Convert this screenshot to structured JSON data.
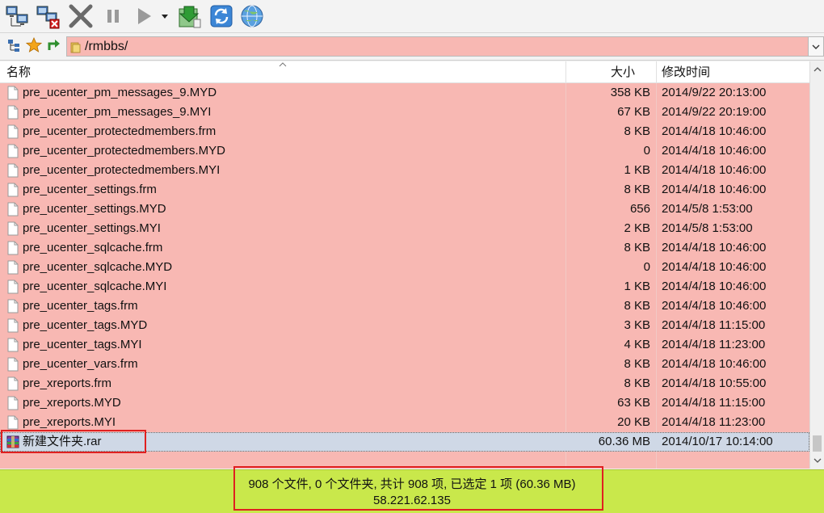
{
  "toolbar": {
    "buttons": [
      {
        "icon": "connect-icon"
      },
      {
        "icon": "disconnect-icon"
      },
      {
        "icon": "cancel-icon"
      },
      {
        "icon": "pause-icon"
      },
      {
        "icon": "play-icon"
      },
      {
        "icon": "sync-download-icon"
      },
      {
        "icon": "refresh-icon"
      },
      {
        "icon": "globe-icon"
      }
    ]
  },
  "address": {
    "path": "/rmbbs/"
  },
  "columns": {
    "name": "名称",
    "size": "大小",
    "date": "修改时间"
  },
  "files": [
    {
      "name": "pre_ucenter_pm_messages_9.MYD",
      "size": "358 KB",
      "date": "2014/9/22 20:13:00"
    },
    {
      "name": "pre_ucenter_pm_messages_9.MYI",
      "size": "67 KB",
      "date": "2014/9/22 20:19:00"
    },
    {
      "name": "pre_ucenter_protectedmembers.frm",
      "size": "8 KB",
      "date": "2014/4/18 10:46:00"
    },
    {
      "name": "pre_ucenter_protectedmembers.MYD",
      "size": "0",
      "date": "2014/4/18 10:46:00"
    },
    {
      "name": "pre_ucenter_protectedmembers.MYI",
      "size": "1 KB",
      "date": "2014/4/18 10:46:00"
    },
    {
      "name": "pre_ucenter_settings.frm",
      "size": "8 KB",
      "date": "2014/4/18 10:46:00"
    },
    {
      "name": "pre_ucenter_settings.MYD",
      "size": "656",
      "date": "2014/5/8 1:53:00"
    },
    {
      "name": "pre_ucenter_settings.MYI",
      "size": "2 KB",
      "date": "2014/5/8 1:53:00"
    },
    {
      "name": "pre_ucenter_sqlcache.frm",
      "size": "8 KB",
      "date": "2014/4/18 10:46:00"
    },
    {
      "name": "pre_ucenter_sqlcache.MYD",
      "size": "0",
      "date": "2014/4/18 10:46:00"
    },
    {
      "name": "pre_ucenter_sqlcache.MYI",
      "size": "1 KB",
      "date": "2014/4/18 10:46:00"
    },
    {
      "name": "pre_ucenter_tags.frm",
      "size": "8 KB",
      "date": "2014/4/18 10:46:00"
    },
    {
      "name": "pre_ucenter_tags.MYD",
      "size": "3 KB",
      "date": "2014/4/18 11:15:00"
    },
    {
      "name": "pre_ucenter_tags.MYI",
      "size": "4 KB",
      "date": "2014/4/18 11:23:00"
    },
    {
      "name": "pre_ucenter_vars.frm",
      "size": "8 KB",
      "date": "2014/4/18 10:46:00"
    },
    {
      "name": "pre_xreports.frm",
      "size": "8 KB",
      "date": "2014/4/18 10:55:00"
    },
    {
      "name": "pre_xreports.MYD",
      "size": "63 KB",
      "date": "2014/4/18 11:15:00"
    },
    {
      "name": "pre_xreports.MYI",
      "size": "20 KB",
      "date": "2014/4/18 11:23:00"
    },
    {
      "name": "新建文件夹.rar",
      "size": "60.36 MB",
      "date": "2014/10/17 10:14:00",
      "selected": true,
      "icon": "rar-archive-icon"
    }
  ],
  "status": {
    "summary": "908 个文件, 0 个文件夹, 共计 908 项, 已选定 1 项 (60.36 MB)",
    "host": "58.221.62.135"
  },
  "colors": {
    "list_bg": "#f8b8b3",
    "status_bg": "#c9e84b",
    "highlight": "#e02020",
    "selected_row": "#cfd8e6"
  }
}
